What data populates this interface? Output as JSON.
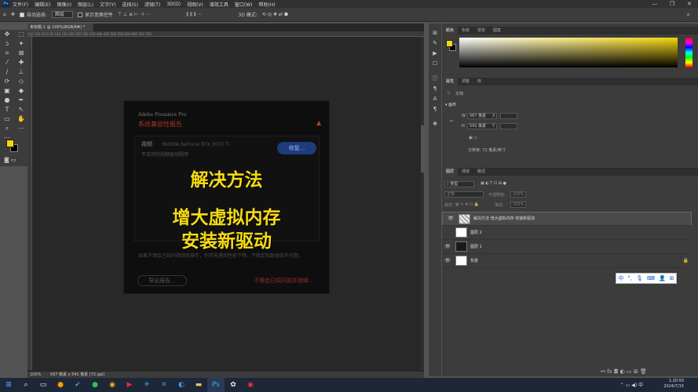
{
  "menubar": {
    "app_icon": "Ps",
    "items": [
      "文件(F)",
      "编辑(E)",
      "图像(I)",
      "图层(L)",
      "文字(Y)",
      "选择(S)",
      "滤镜(T)",
      "3D(D)",
      "视图(V)",
      "增效工具",
      "窗口(W)",
      "帮助(H)"
    ],
    "window_controls": [
      "—",
      "❐",
      "✕"
    ]
  },
  "options": {
    "auto_select_label": "自动选择:",
    "auto_select_value": "图层",
    "show_transform_label": "显示变换控件",
    "mode_3d": "3D 模式:"
  },
  "document": {
    "tab": "未标题-1 @ 100%(RGB/8#) *",
    "ruler_marks": "150  100  50  0  50  100  150  200  250  300  350  400  450  500  550  600  650  700  750",
    "zoom": "100%",
    "size_info": "567 像素 x 541 像素 (72 ppi)"
  },
  "dialog": {
    "app_name": "Adobe Premiere Pro",
    "title": "系统兼容性报告",
    "video_label": "视频",
    "gpu": "NVIDIA GeForce RTX 3070 Ti",
    "driver_msg": "不支持的视频驱动程序",
    "fix_button": "修复...",
    "note": "如果不理会已知问题继续操作，则可能遇到性能下降、不稳定和数据丢失问题。",
    "export_button": "导出报告...",
    "ignore_link": "不理会已知问题并继续..."
  },
  "overlay": {
    "line1": "解决方法",
    "line2": "增大虚拟内存",
    "line3": "安装新驱动"
  },
  "color_panel": {
    "tabs": [
      "颜色",
      "色板",
      "渐变",
      "图案"
    ],
    "foreground": "#f5d60e",
    "background": "#000000"
  },
  "properties_panel": {
    "tabs": [
      "属性",
      "调整",
      "库"
    ],
    "doc_label": "文档",
    "canvas_label": "画布",
    "w_label": "W",
    "w_value": "567 像素",
    "h_label": "H",
    "h_value": "541 像素",
    "x_label": "X",
    "y_label": "Y",
    "resolution": "分辨率: 72 像素/英寸"
  },
  "layers_panel": {
    "tabs": [
      "图层",
      "通道",
      "路径"
    ],
    "filter": "类型",
    "blend_mode": "正常",
    "opacity_label": "不透明度:",
    "opacity_value": "100%",
    "lock_label": "锁定:",
    "fill_label": "填充:",
    "fill_value": "100%",
    "layers": [
      {
        "name": "解决方法    增大虚拟内存  安装新驱动",
        "visible": true
      },
      {
        "name": "图层 2",
        "visible": false
      },
      {
        "name": "图层 1",
        "visible": true
      },
      {
        "name": "背景",
        "visible": true
      }
    ]
  },
  "ime_bar": [
    "中",
    "°,",
    "🎙",
    "⌨",
    "👤",
    "⊞"
  ],
  "taskbar": {
    "time": "1:20:50",
    "date": "2024/7/15",
    "lang": "中"
  }
}
